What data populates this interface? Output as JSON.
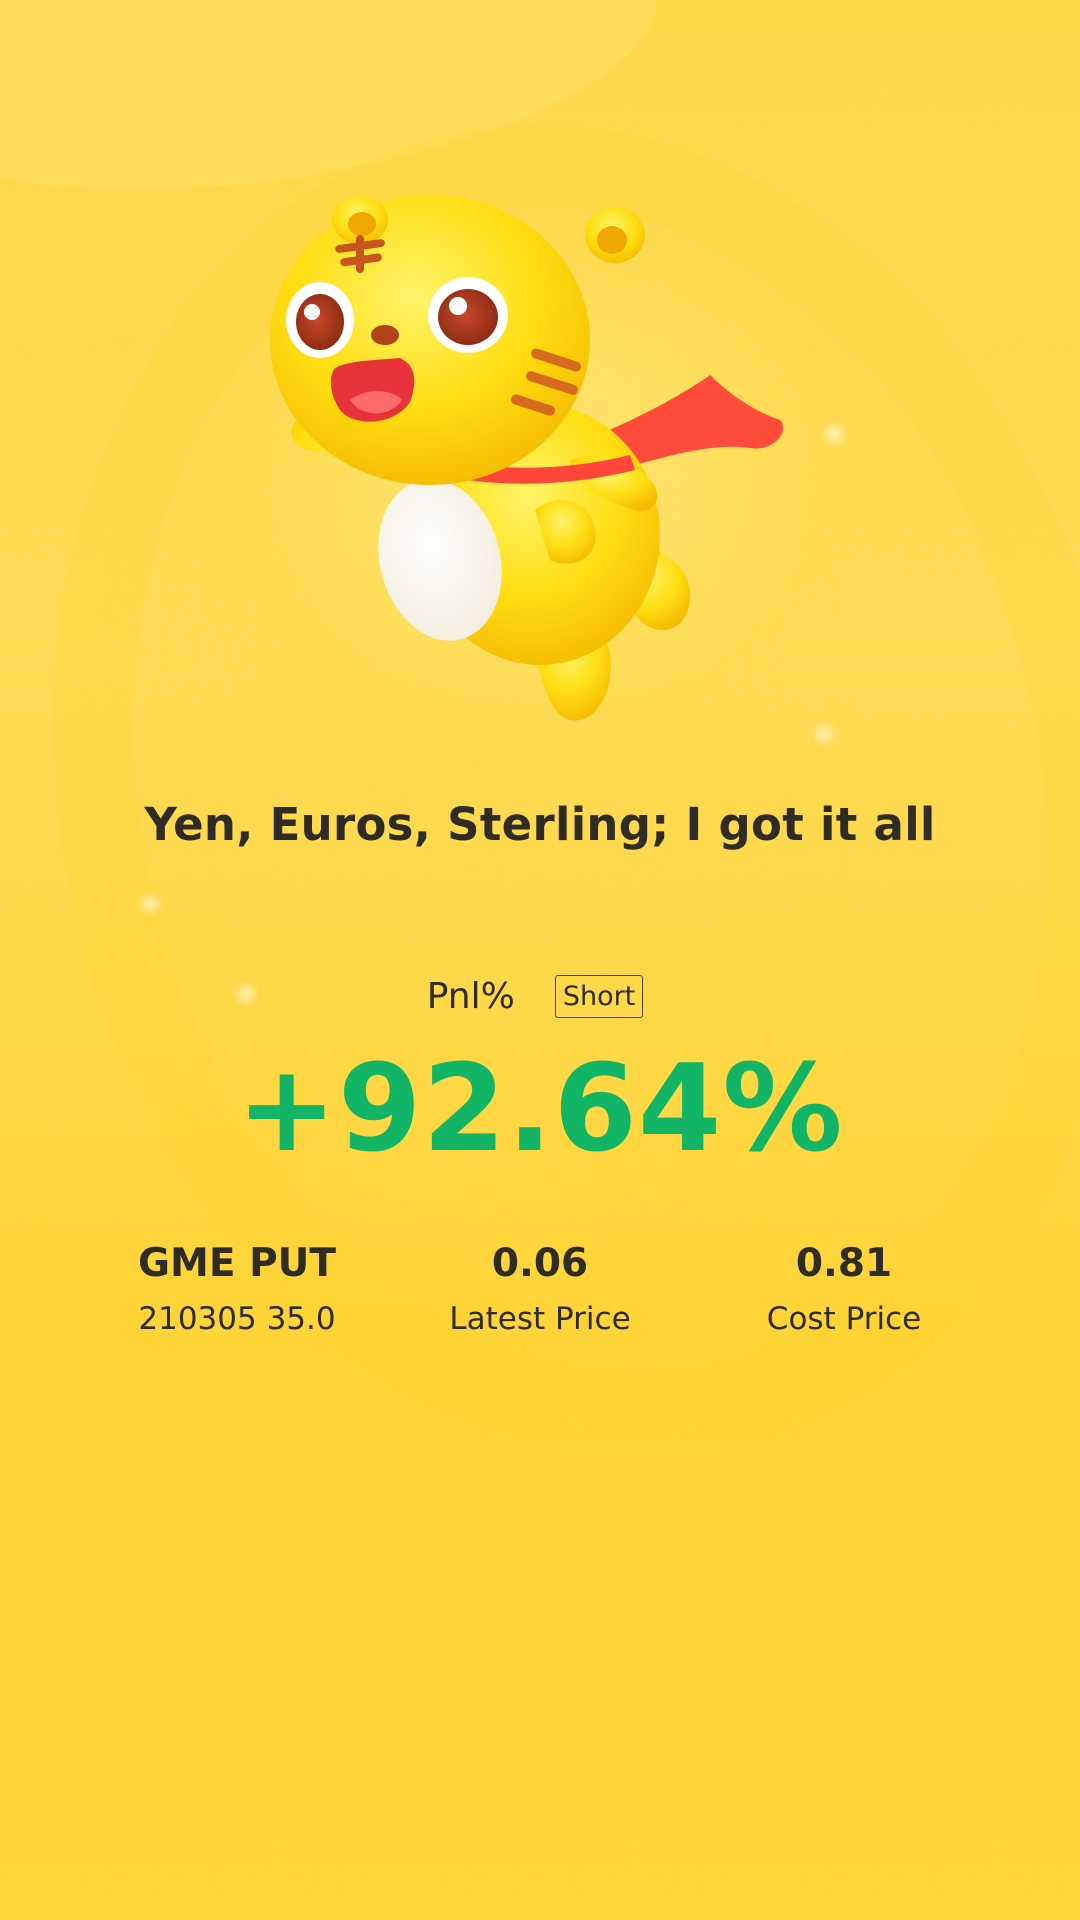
{
  "mascot": {
    "icon": "tiger-mascot-icon"
  },
  "slogan": "Yen, Euros, Sterling; I got it all",
  "pnl": {
    "label": "Pnl%",
    "direction": "Short",
    "value": "+92.64%",
    "value_color": "#12b566"
  },
  "position": {
    "symbol": "GME PUT",
    "contract": "210305 35.0",
    "latest_price": "0.06",
    "latest_price_label": "Latest Price",
    "cost_price": "0.81",
    "cost_price_label": "Cost Price"
  },
  "colors": {
    "background": "#ffd94a",
    "text": "#2f2b25",
    "positive": "#12b566"
  }
}
